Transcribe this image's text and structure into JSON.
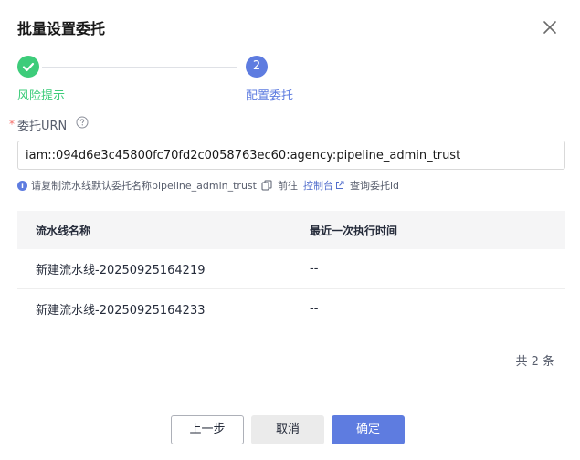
{
  "dialog": {
    "title": "批量设置委托",
    "close_icon": "close-icon"
  },
  "steps": [
    {
      "label": "风险提示",
      "status": "done",
      "icon": "check-icon",
      "color": "#3dcc7a"
    },
    {
      "label": "配置委托",
      "status": "active",
      "number": "2",
      "color": "#5e7ce0"
    }
  ],
  "field": {
    "required_mark": "*",
    "label": "委托URN",
    "help_icon": "question-circle-icon",
    "value": "iam::094d6e3c45800fc70fd2c0058763ec60:agency:pipeline_admin_trust"
  },
  "hint": {
    "info_icon": "info-circle-icon",
    "text": "请复制流水线默认委托名称pipeline_admin_trust",
    "copy_icon": "copy-icon",
    "goto_text": "前往",
    "console_link": "控制台",
    "external_icon": "external-link-icon",
    "query_link": "查询委托id"
  },
  "table": {
    "columns": [
      "流水线名称",
      "最近一次执行时间"
    ],
    "rows": [
      [
        "新建流水线-20250925164219",
        "--"
      ],
      [
        "新建流水线-20250925164233",
        "--"
      ]
    ]
  },
  "pagination": {
    "total_label": "共 2 条"
  },
  "footer": {
    "prev_label": "上一步",
    "cancel_label": "取消",
    "confirm_label": "确定"
  },
  "colors": {
    "primary": "#5e7ce0",
    "success": "#3dcc7a",
    "danger": "#f66f6a"
  }
}
